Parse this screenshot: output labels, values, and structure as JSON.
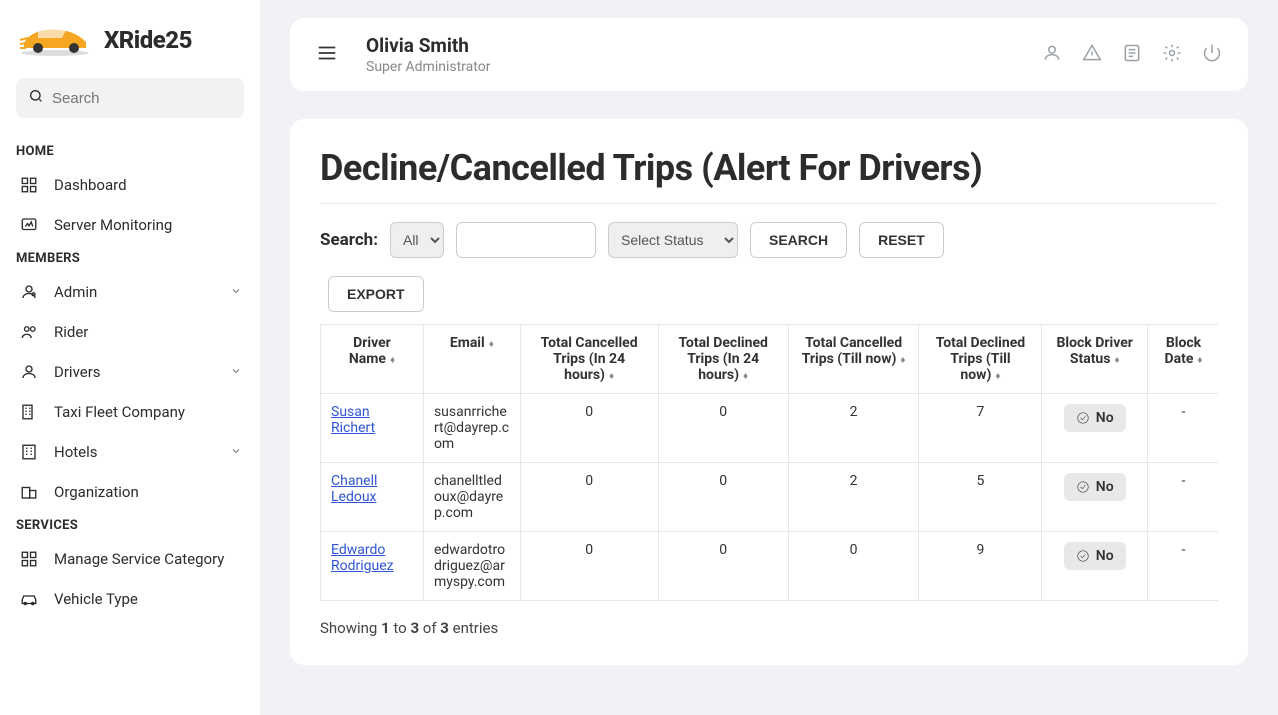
{
  "logo": {
    "brand": "XRide25"
  },
  "search": {
    "placeholder": "Search"
  },
  "nav": {
    "home_label": "HOME",
    "members_label": "MEMBERS",
    "services_label": "SERVICES",
    "dashboard": "Dashboard",
    "server_monitoring": "Server Monitoring",
    "admin": "Admin",
    "rider": "Rider",
    "drivers": "Drivers",
    "taxi_fleet": "Taxi Fleet Company",
    "hotels": "Hotels",
    "organization": "Organization",
    "manage_service_category": "Manage Service Category",
    "vehicle_type": "Vehicle Type"
  },
  "header": {
    "user_name": "Olivia Smith",
    "user_role": "Super Administrator"
  },
  "page": {
    "title": "Decline/Cancelled Trips (Alert For Drivers)"
  },
  "filters": {
    "search_label": "Search:",
    "type_option": "All",
    "status_option": "Select Status",
    "search_btn": "SEARCH",
    "reset_btn": "RESET",
    "export_btn": "EXPORT"
  },
  "table": {
    "headers": {
      "driver_name": "Driver Name",
      "email": "Email",
      "cancelled_24h": "Total Cancelled Trips (In 24 hours)",
      "declined_24h": "Total Declined Trips (In 24 hours)",
      "cancelled_total": "Total Cancelled Trips (Till now)",
      "declined_total": "Total Declined Trips (Till now)",
      "block_status": "Block Driver Status",
      "block_date": "Block Date"
    },
    "rows": [
      {
        "name": "Susan Richert",
        "email": "susanrrichert@dayrep.com",
        "c24": "0",
        "d24": "0",
        "ctot": "2",
        "dtot": "7",
        "block": "No",
        "date": "-"
      },
      {
        "name": "Chanell Ledoux",
        "email": "chanelltledoux@dayrep.com",
        "c24": "0",
        "d24": "0",
        "ctot": "2",
        "dtot": "5",
        "block": "No",
        "date": "-"
      },
      {
        "name": "Edwardo Rodriguez",
        "email": "edwardotrodriguez@armyspy.com",
        "c24": "0",
        "d24": "0",
        "ctot": "0",
        "dtot": "9",
        "block": "No",
        "date": "-"
      }
    ]
  },
  "pagination": {
    "prefix": "Showing ",
    "from": "1",
    "to_word": " to ",
    "to": "3",
    "of_word": " of ",
    "total": "3",
    "suffix": " entries"
  }
}
